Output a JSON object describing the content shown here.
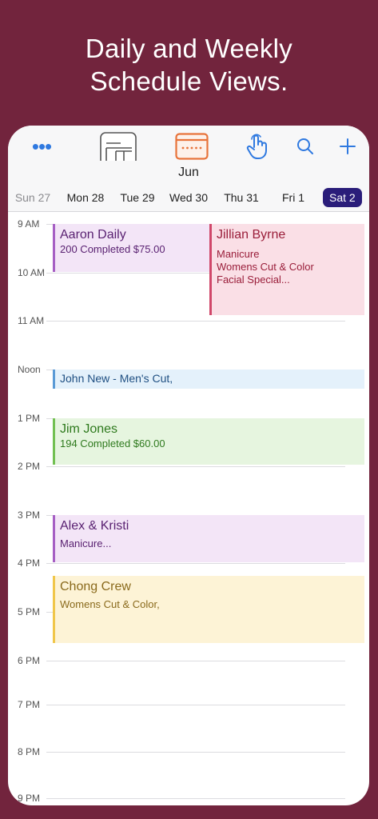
{
  "headline": {
    "line1": "Daily and Weekly",
    "line2": "Schedule Views."
  },
  "toolbar": {
    "more_icon": "ellipsis-icon",
    "day_view_icon": "day-view-icon",
    "week_view_icon": "week-view-icon",
    "gesture_icon": "hand-tap-icon",
    "search_icon": "search-icon",
    "add_icon": "plus-icon",
    "accent_color": "#2f79e0",
    "active_view_color": "#e8733a"
  },
  "calendar": {
    "month": "Jun",
    "days": [
      {
        "label": "Sun 27"
      },
      {
        "label": "Mon 28"
      },
      {
        "label": "Tue 29"
      },
      {
        "label": "Wed 30"
      },
      {
        "label": "Thu 31"
      },
      {
        "label": "Fri 1"
      },
      {
        "label": "Sat 2"
      }
    ],
    "selected_day": "Sat 2",
    "hours": [
      "9 AM",
      "10 AM",
      "11 AM",
      "Noon",
      "1 PM",
      "2 PM",
      "3 PM",
      "4 PM",
      "5 PM",
      "6 PM",
      "7 PM",
      "8 PM",
      "9 PM"
    ]
  },
  "events": [
    {
      "title": "Aaron Daily",
      "lines": [
        "200 Completed $75.00"
      ],
      "color": "purple"
    },
    {
      "title": "Jillian Byrne",
      "lines": [
        "Manicure",
        "Womens Cut & Color",
        "Facial Special..."
      ],
      "color": "pink"
    },
    {
      "title": "John New - Men's Cut,",
      "lines": [],
      "color": "blue"
    },
    {
      "title": "Jim  Jones",
      "lines": [
        "194 Completed $60.00"
      ],
      "color": "green"
    },
    {
      "title": "Alex & Kristi",
      "lines": [
        "Manicure..."
      ],
      "color": "purple"
    },
    {
      "title": "Chong Crew",
      "lines": [
        "Womens Cut & Color,"
      ],
      "color": "yellow"
    }
  ]
}
